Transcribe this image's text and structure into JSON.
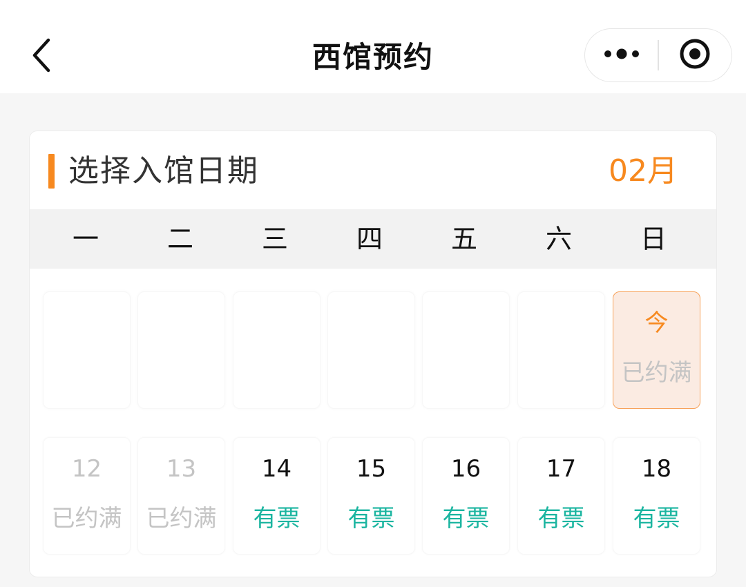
{
  "nav": {
    "title": "西馆预约"
  },
  "icons": {
    "back": "chevron-left-icon",
    "more": "more-dots-icon",
    "close": "record-circle-icon"
  },
  "colors": {
    "accent": "#f7891f",
    "available": "#1bb5a0",
    "full": "#c4c4c4",
    "today_bg": "#fbebe2",
    "today_border": "#f7a25a"
  },
  "calendar": {
    "title": "选择入馆日期",
    "month": "02月",
    "weekdays": [
      "一",
      "二",
      "三",
      "四",
      "五",
      "六",
      "日"
    ],
    "week1": [
      {
        "day": "",
        "status": "",
        "kind": "empty"
      },
      {
        "day": "",
        "status": "",
        "kind": "empty"
      },
      {
        "day": "",
        "status": "",
        "kind": "empty"
      },
      {
        "day": "",
        "status": "",
        "kind": "empty"
      },
      {
        "day": "",
        "status": "",
        "kind": "empty"
      },
      {
        "day": "",
        "status": "",
        "kind": "empty"
      },
      {
        "day": "今",
        "status": "已约满",
        "kind": "today"
      }
    ],
    "week2": [
      {
        "day": "12",
        "status": "已约满",
        "kind": "full"
      },
      {
        "day": "13",
        "status": "已约满",
        "kind": "full"
      },
      {
        "day": "14",
        "status": "有票",
        "kind": "available"
      },
      {
        "day": "15",
        "status": "有票",
        "kind": "available"
      },
      {
        "day": "16",
        "status": "有票",
        "kind": "available"
      },
      {
        "day": "17",
        "status": "有票",
        "kind": "available"
      },
      {
        "day": "18",
        "status": "有票",
        "kind": "available"
      }
    ]
  }
}
